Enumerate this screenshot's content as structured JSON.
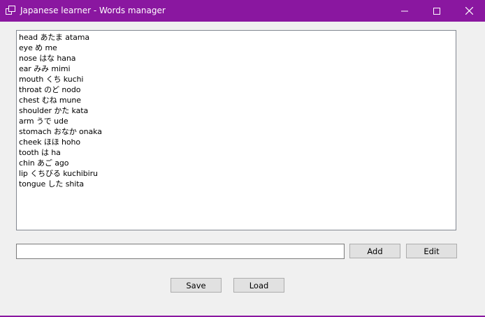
{
  "window": {
    "title": "Japanese learner - Words manager",
    "accent": "#8a17a0",
    "app_icon": "window-app-icon",
    "controls": [
      "minimize-icon",
      "maximize-icon",
      "close-icon"
    ]
  },
  "words": [
    "head あたま atama",
    "eye め me",
    "nose はな hana",
    "ear みみ mimi",
    "mouth くち kuchi",
    "throat のど nodo",
    "chest むね mune",
    "shoulder かた kata",
    "arm うで ude",
    "stomach おなか onaka",
    "cheek ほほ hoho",
    "tooth は ha",
    "chin あご ago",
    "lip くちびる kuchibiru",
    "tongue した shita"
  ],
  "input": {
    "value": "",
    "placeholder": ""
  },
  "buttons": {
    "add": "Add",
    "edit": "Edit",
    "save": "Save",
    "load": "Load"
  }
}
